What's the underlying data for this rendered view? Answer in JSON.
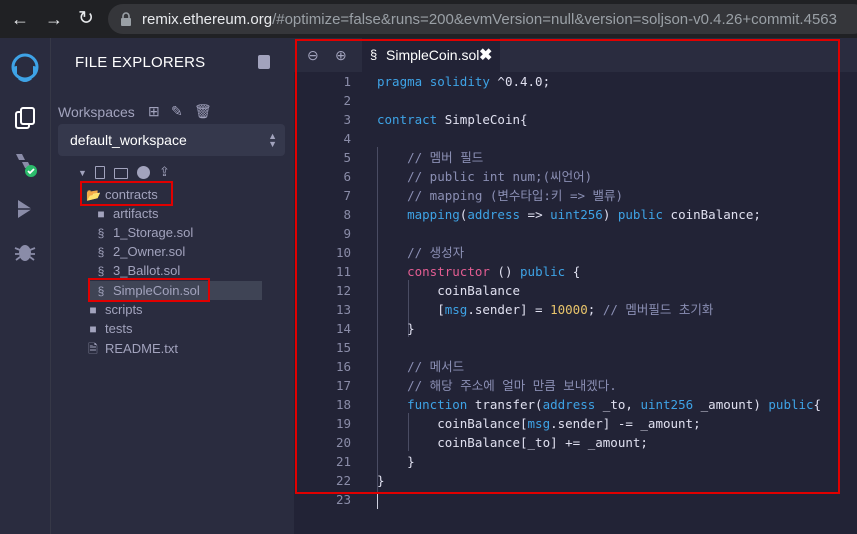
{
  "browser": {
    "url_host": "remix.ethereum.org",
    "url_rest": "/#optimize=false&runs=200&evmVersion=null&version=soljson-v0.4.26+commit.4563"
  },
  "icon_panel": {
    "items": [
      "remix-logo-icon",
      "file-explorer-icon",
      "solidity-compiler-icon",
      "deploy-run-icon",
      "debugger-icon"
    ]
  },
  "side_panel": {
    "title": "FILE EXPLORERS",
    "workspaces_label": "Workspaces",
    "workspace_value": "default_workspace",
    "tree": [
      {
        "label": "contracts",
        "type": "folder-open"
      },
      {
        "label": "artifacts",
        "type": "folder"
      },
      {
        "label": "1_Storage.sol",
        "type": "sol"
      },
      {
        "label": "2_Owner.sol",
        "type": "sol"
      },
      {
        "label": "3_Ballot.sol",
        "type": "sol"
      },
      {
        "label": "SimpleCoin.sol",
        "type": "sol"
      },
      {
        "label": "scripts",
        "type": "folder"
      },
      {
        "label": "tests",
        "type": "folder"
      },
      {
        "label": "README.txt",
        "type": "file"
      }
    ]
  },
  "editor": {
    "tab_label": "SimpleCoin.sol",
    "line_numbers": [
      "1",
      "2",
      "3",
      "4",
      "5",
      "6",
      "7",
      "8",
      "9",
      "10",
      "11",
      "12",
      "13",
      "14",
      "15",
      "16",
      "17",
      "18",
      "19",
      "20",
      "21",
      "22",
      "23"
    ]
  },
  "colors": {
    "accent_keyword": "#3ea3e6",
    "comment": "#8b8fb4",
    "keyword_pink": "#e35d92",
    "number": "#e8c46b",
    "highlight_box": "#e00000"
  }
}
